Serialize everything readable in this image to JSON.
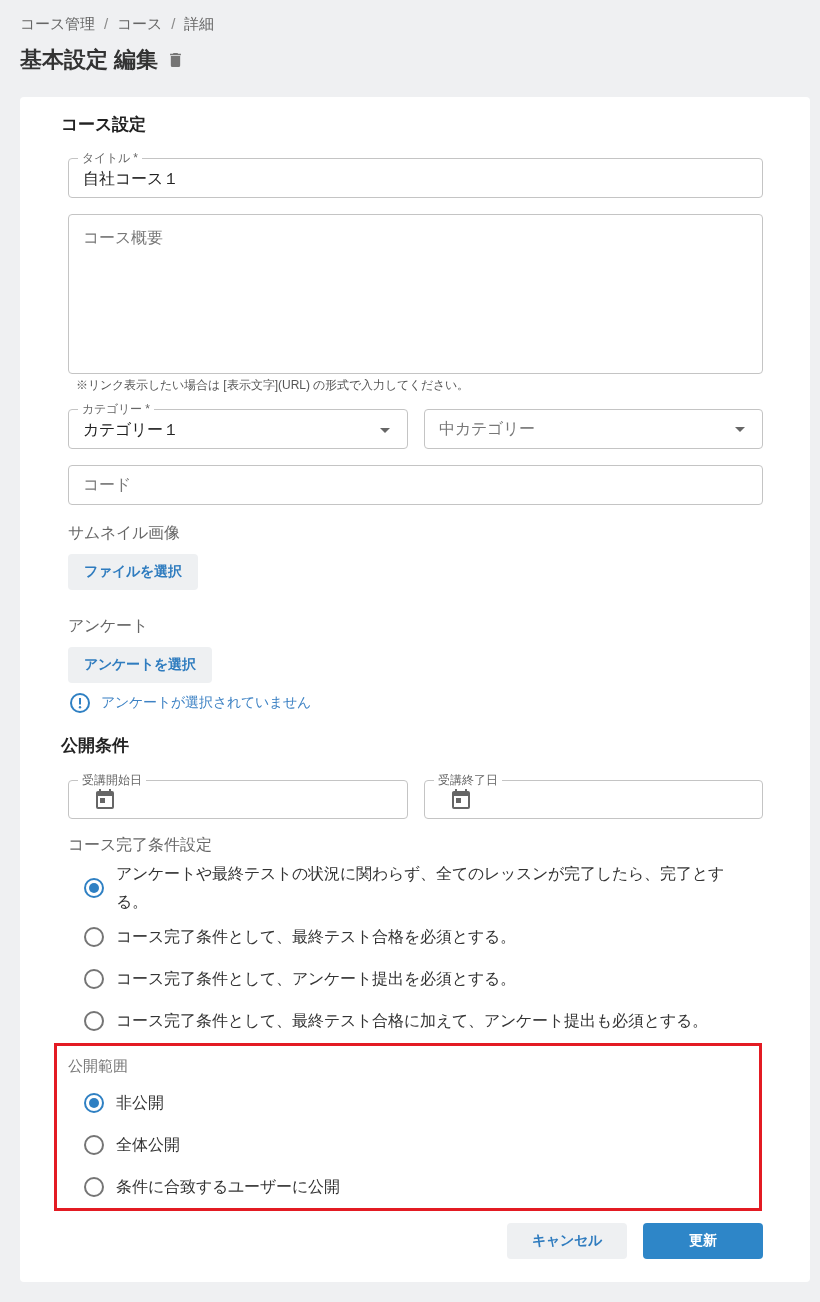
{
  "breadcrumb": [
    {
      "kind": "crumb",
      "label": "コース管理"
    },
    {
      "kind": "separator",
      "label": "/"
    },
    {
      "kind": "crumb",
      "label": "コース"
    },
    {
      "kind": "separator",
      "label": "/"
    },
    {
      "kind": "crumb",
      "label": "詳細"
    }
  ],
  "page_title": "基本設定 編集",
  "course_settings": {
    "heading": "コース設定",
    "title_field": {
      "label": "タイトル *",
      "value": "自社コース１"
    },
    "summary_field": {
      "placeholder": "コース概要",
      "hint": "※リンク表示したい場合は [表示文字](URL) の形式で入力してください。"
    },
    "category_select": {
      "label": "カテゴリー *",
      "value": "カテゴリー１"
    },
    "subcategory_select": {
      "placeholder": "中カテゴリー"
    },
    "code_field": {
      "placeholder": "コード"
    },
    "thumbnail": {
      "label": "サムネイル画像",
      "button": "ファイルを選択"
    },
    "survey": {
      "label": "アンケート",
      "button": "アンケートを選択",
      "notice": "アンケートが選択されていません"
    }
  },
  "publish_conditions": {
    "heading": "公開条件",
    "date_fields": [
      {
        "label": "受講開始日"
      },
      {
        "label": "受講終了日"
      }
    ],
    "completion_rule": {
      "label": "コース完了条件設定",
      "options": [
        {
          "label": "アンケートや最終テストの状況に関わらず、全てのレッスンが完了したら、完了とする。",
          "selected": true
        },
        {
          "label": "コース完了条件として、最終テスト合格を必須とする。",
          "selected": false
        },
        {
          "label": "コース完了条件として、アンケート提出を必須とする。",
          "selected": false
        },
        {
          "label": "コース完了条件として、最終テスト合格に加えて、アンケート提出も必須とする。",
          "selected": false
        }
      ]
    },
    "visibility": {
      "label": "公開範囲",
      "highlighted": true,
      "options": [
        {
          "label": "非公開",
          "selected": true
        },
        {
          "label": "全体公開",
          "selected": false
        },
        {
          "label": "条件に合致するユーザーに公開",
          "selected": false
        }
      ]
    }
  },
  "actions": [
    {
      "kind": "secondary",
      "label": "キャンセル"
    },
    {
      "kind": "primary",
      "label": "更新"
    }
  ]
}
